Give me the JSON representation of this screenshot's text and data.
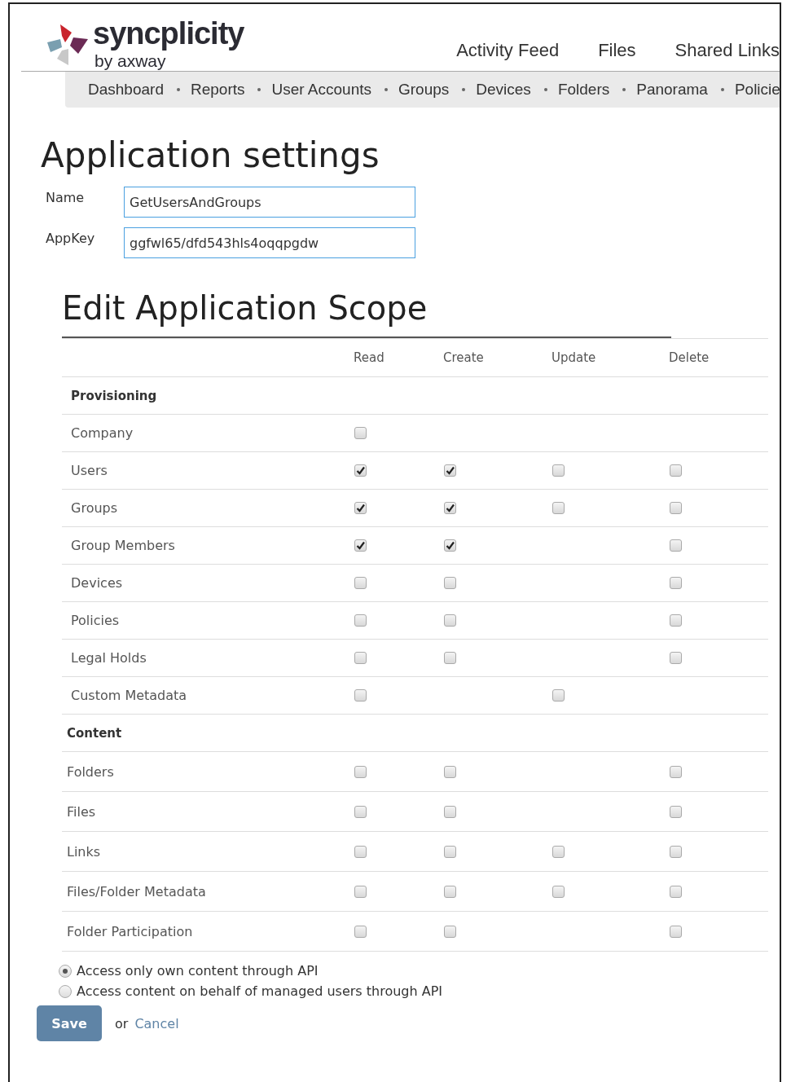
{
  "logo": {
    "name": "syncplicity",
    "tagline": "by axway"
  },
  "top_nav": [
    "Activity Feed",
    "Files",
    "Shared Links"
  ],
  "sub_nav": [
    "Dashboard",
    "Reports",
    "User Accounts",
    "Groups",
    "Devices",
    "Folders",
    "Panorama",
    "Policie"
  ],
  "title": "Application settings",
  "fields": [
    {
      "label": "Name",
      "value": "GetUsersAndGroups"
    },
    {
      "label": "AppKey",
      "value": "ggfwl65/dfd543hls4oqqpgdw"
    }
  ],
  "scope": {
    "title": "Edit Application Scope",
    "columns": [
      "Read",
      "Create",
      "Update",
      "Delete"
    ],
    "sections": [
      {
        "name": "Provisioning",
        "rows": [
          {
            "label": "Company",
            "read": false
          },
          {
            "label": "Users",
            "read": true,
            "create": true,
            "update": false,
            "delete": false
          },
          {
            "label": "Groups",
            "read": true,
            "create": true,
            "update": false,
            "delete": false
          },
          {
            "label": "Group Members",
            "read": true,
            "create": true,
            "delete": false
          },
          {
            "label": "Devices",
            "read": false,
            "create": false,
            "delete": false
          },
          {
            "label": "Policies",
            "read": false,
            "create": false,
            "delete": false
          },
          {
            "label": "Legal Holds",
            "read": false,
            "create": false,
            "delete": false
          },
          {
            "label": "Custom Metadata",
            "read": false,
            "update": false
          }
        ]
      },
      {
        "name": "Content",
        "rows": [
          {
            "label": "Folders",
            "read": false,
            "create": false,
            "delete": false
          },
          {
            "label": "Files",
            "read": false,
            "create": false,
            "delete": false
          },
          {
            "label": "Links",
            "read": false,
            "create": false,
            "update": false,
            "delete": false
          },
          {
            "label": "Files/Folder Metadata",
            "read": false,
            "create": false,
            "update": false,
            "delete": false
          },
          {
            "label": "Folder Participation",
            "read": false,
            "create": false,
            "delete": false
          }
        ]
      }
    ]
  },
  "access_options": [
    {
      "label": "Access only own content through API",
      "selected": true
    },
    {
      "label": "Access content on behalf of managed users through API",
      "selected": false
    }
  ],
  "actions": {
    "save": "Save",
    "or": "or",
    "cancel": "Cancel"
  }
}
